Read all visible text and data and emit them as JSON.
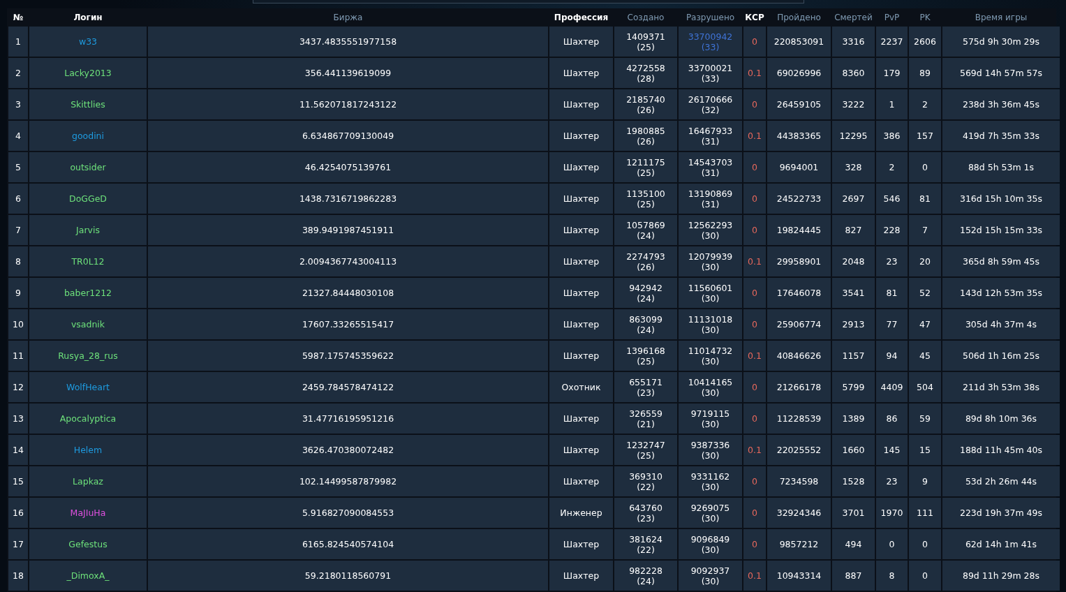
{
  "table": {
    "columns": [
      {
        "label": "№",
        "sortable": false
      },
      {
        "label": "Логин",
        "sortable": false
      },
      {
        "label": "Биржа",
        "sortable": true
      },
      {
        "label": "Профессия",
        "sortable": false
      },
      {
        "label": "Создано",
        "sortable": true
      },
      {
        "label": "Разрушено",
        "sortable": true
      },
      {
        "label": "КСР",
        "sortable": false
      },
      {
        "label": "Пройдено",
        "sortable": true
      },
      {
        "label": "Смертей",
        "sortable": true
      },
      {
        "label": "PvP",
        "sortable": true
      },
      {
        "label": "PK",
        "sortable": true
      },
      {
        "label": "Время игры",
        "sortable": true
      }
    ],
    "rows": [
      {
        "n": "1",
        "login": "w33",
        "color": "#1e9be0",
        "exchange": "3437.4835551977158",
        "profession": "Шахтер",
        "created": {
          "value": "1409371",
          "level": "(25)"
        },
        "destroyed": {
          "value": "33700942",
          "level": "(33)",
          "highlight": true
        },
        "ksr": "0",
        "passed": "220853091",
        "deaths": "3316",
        "pvp": "2237",
        "pk": "2606",
        "time": "575d 9h 30m 29s"
      },
      {
        "n": "2",
        "login": "Lacky2013",
        "color": "#6de07a",
        "exchange": "356.441139619099",
        "profession": "Шахтер",
        "created": {
          "value": "4272558",
          "level": "(28)"
        },
        "destroyed": {
          "value": "33700021",
          "level": "(33)",
          "highlight": false
        },
        "ksr": "0.1",
        "passed": "69026996",
        "deaths": "8360",
        "pvp": "179",
        "pk": "89",
        "time": "569d 14h 57m 57s"
      },
      {
        "n": "3",
        "login": "Skittlies",
        "color": "#6de07a",
        "exchange": "11.562071817243122",
        "profession": "Шахтер",
        "created": {
          "value": "2185740",
          "level": "(26)"
        },
        "destroyed": {
          "value": "26170666",
          "level": "(32)",
          "highlight": false
        },
        "ksr": "0",
        "passed": "26459105",
        "deaths": "3222",
        "pvp": "1",
        "pk": "2",
        "time": "238d 3h 36m 45s"
      },
      {
        "n": "4",
        "login": "goodini",
        "color": "#1e9be0",
        "exchange": "6.634867709130049",
        "profession": "Шахтер",
        "created": {
          "value": "1980885",
          "level": "(26)"
        },
        "destroyed": {
          "value": "16467933",
          "level": "(31)",
          "highlight": false
        },
        "ksr": "0.1",
        "passed": "44383365",
        "deaths": "12295",
        "pvp": "386",
        "pk": "157",
        "time": "419d 7h 35m 33s"
      },
      {
        "n": "5",
        "login": "outsider",
        "color": "#6de07a",
        "exchange": "46.4254075139761",
        "profession": "Шахтер",
        "created": {
          "value": "1211175",
          "level": "(25)"
        },
        "destroyed": {
          "value": "14543703",
          "level": "(31)",
          "highlight": false
        },
        "ksr": "0",
        "passed": "9694001",
        "deaths": "328",
        "pvp": "2",
        "pk": "0",
        "time": "88d 5h 53m 1s"
      },
      {
        "n": "6",
        "login": "DoGGeD",
        "color": "#6de07a",
        "exchange": "1438.7316719862283",
        "profession": "Шахтер",
        "created": {
          "value": "1135100",
          "level": "(25)"
        },
        "destroyed": {
          "value": "13190869",
          "level": "(31)",
          "highlight": false
        },
        "ksr": "0",
        "passed": "24522733",
        "deaths": "2697",
        "pvp": "546",
        "pk": "81",
        "time": "316d 15h 10m 35s"
      },
      {
        "n": "7",
        "login": "Jarvis",
        "color": "#6de07a",
        "exchange": "389.9491987451911",
        "profession": "Шахтер",
        "created": {
          "value": "1057869",
          "level": "(24)"
        },
        "destroyed": {
          "value": "12562293",
          "level": "(30)",
          "highlight": false
        },
        "ksr": "0",
        "passed": "19824445",
        "deaths": "827",
        "pvp": "228",
        "pk": "7",
        "time": "152d 15h 15m 33s"
      },
      {
        "n": "8",
        "login": "TR0L12",
        "color": "#6de07a",
        "exchange": "2.0094367743004113",
        "profession": "Шахтер",
        "created": {
          "value": "2274793",
          "level": "(26)"
        },
        "destroyed": {
          "value": "12079939",
          "level": "(30)",
          "highlight": false
        },
        "ksr": "0.1",
        "passed": "29958901",
        "deaths": "2048",
        "pvp": "23",
        "pk": "20",
        "time": "365d 8h 59m 45s"
      },
      {
        "n": "9",
        "login": "baber1212",
        "color": "#6de07a",
        "exchange": "21327.84448030108",
        "profession": "Шахтер",
        "created": {
          "value": "942942",
          "level": "(24)"
        },
        "destroyed": {
          "value": "11560601",
          "level": "(30)",
          "highlight": false
        },
        "ksr": "0",
        "passed": "17646078",
        "deaths": "3541",
        "pvp": "81",
        "pk": "52",
        "time": "143d 12h 53m 35s"
      },
      {
        "n": "10",
        "login": "vsadnik",
        "color": "#6de07a",
        "exchange": "17607.33265515417",
        "profession": "Шахтер",
        "created": {
          "value": "863099",
          "level": "(24)"
        },
        "destroyed": {
          "value": "11131018",
          "level": "(30)",
          "highlight": false
        },
        "ksr": "0",
        "passed": "25906774",
        "deaths": "2913",
        "pvp": "77",
        "pk": "47",
        "time": "305d 4h 37m 4s"
      },
      {
        "n": "11",
        "login": "Rusya_28_rus",
        "color": "#6de07a",
        "exchange": "5987.175745359622",
        "profession": "Шахтер",
        "created": {
          "value": "1396168",
          "level": "(25)"
        },
        "destroyed": {
          "value": "11014732",
          "level": "(30)",
          "highlight": false
        },
        "ksr": "0.1",
        "passed": "40846626",
        "deaths": "1157",
        "pvp": "94",
        "pk": "45",
        "time": "506d 1h 16m 25s"
      },
      {
        "n": "12",
        "login": "WolfHeart",
        "color": "#1e9be0",
        "exchange": "2459.784578474122",
        "profession": "Охотник",
        "created": {
          "value": "655171",
          "level": "(23)"
        },
        "destroyed": {
          "value": "10414165",
          "level": "(30)",
          "highlight": false
        },
        "ksr": "0",
        "passed": "21266178",
        "deaths": "5799",
        "pvp": "4409",
        "pk": "504",
        "time": "211d 3h 53m 38s"
      },
      {
        "n": "13",
        "login": "Apocalyptica",
        "color": "#6de07a",
        "exchange": "31.47716195951216",
        "profession": "Шахтер",
        "created": {
          "value": "326559",
          "level": "(21)"
        },
        "destroyed": {
          "value": "9719115",
          "level": "(30)",
          "highlight": false
        },
        "ksr": "0",
        "passed": "11228539",
        "deaths": "1389",
        "pvp": "86",
        "pk": "59",
        "time": "89d 8h 10m 36s"
      },
      {
        "n": "14",
        "login": "Helem",
        "color": "#1e9be0",
        "exchange": "3626.470380072482",
        "profession": "Шахтер",
        "created": {
          "value": "1232747",
          "level": "(25)"
        },
        "destroyed": {
          "value": "9387336",
          "level": "(30)",
          "highlight": false
        },
        "ksr": "0.1",
        "passed": "22025552",
        "deaths": "1660",
        "pvp": "145",
        "pk": "15",
        "time": "188d 11h 45m 40s"
      },
      {
        "n": "15",
        "login": "Lapkaz",
        "color": "#6de07a",
        "exchange": "102.14499587879982",
        "profession": "Шахтер",
        "created": {
          "value": "369310",
          "level": "(22)"
        },
        "destroyed": {
          "value": "9331162",
          "level": "(30)",
          "highlight": false
        },
        "ksr": "0",
        "passed": "7234598",
        "deaths": "1528",
        "pvp": "23",
        "pk": "9",
        "time": "53d 2h 26m 44s"
      },
      {
        "n": "16",
        "login": "MaJIuHa",
        "color": "#e050e0",
        "exchange": "5.916827090084553",
        "profession": "Инженер",
        "created": {
          "value": "643760",
          "level": "(23)"
        },
        "destroyed": {
          "value": "9269075",
          "level": "(30)",
          "highlight": false
        },
        "ksr": "0",
        "passed": "32924346",
        "deaths": "3701",
        "pvp": "1970",
        "pk": "111",
        "time": "223d 19h 37m 49s"
      },
      {
        "n": "17",
        "login": "Gefestus",
        "color": "#6de07a",
        "exchange": "6165.824540574104",
        "profession": "Шахтер",
        "created": {
          "value": "381624",
          "level": "(22)"
        },
        "destroyed": {
          "value": "9096849",
          "level": "(30)",
          "highlight": false
        },
        "ksr": "0",
        "passed": "9857212",
        "deaths": "494",
        "pvp": "0",
        "pk": "0",
        "time": "62d 14h 1m 41s"
      },
      {
        "n": "18",
        "login": "_DimoxA_",
        "color": "#6de07a",
        "exchange": "59.2180118560791",
        "profession": "Шахтер",
        "created": {
          "value": "982228",
          "level": "(24)"
        },
        "destroyed": {
          "value": "9092937",
          "level": "(30)",
          "highlight": false
        },
        "ksr": "0.1",
        "passed": "10943314",
        "deaths": "887",
        "pvp": "8",
        "pk": "0",
        "time": "89d 11h 29m 28s"
      }
    ]
  }
}
